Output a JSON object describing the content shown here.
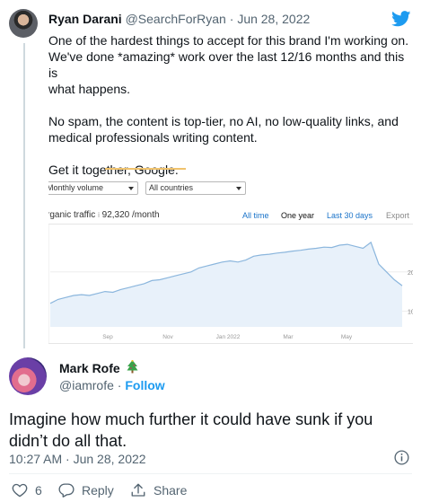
{
  "tweet": {
    "author_name": "Ryan Darani",
    "author_handle": "@SearchForRyan",
    "separator": " · ",
    "date": "Jun 28, 2022",
    "paragraphs": [
      "One of the hardest things to accept for this brand I'm working on.\nWe've done *amazing* work over the last 12/16 months and this is\nwhat happens.",
      "No spam, the content is top-tier, no AI, no low-quality links, and\nmedical professionals writing content.",
      "Get it together, Google."
    ]
  },
  "embedded_screenshot": {
    "volume_select": "Monthly volume",
    "country_select": "All countries",
    "metric_label": "rganic traffic",
    "info_glyph": "i",
    "metric_value": "92,320 /month",
    "ranges": {
      "all_time": "All time",
      "one_year": "One year",
      "last_30": "Last 30 days",
      "export": "Export"
    },
    "selected_range": "One year",
    "accent_color": "#1a73c9",
    "chart_data": {
      "type": "area",
      "title": "",
      "xlabel": "",
      "ylabel": "",
      "x_ticks": [
        "Sep",
        "Nov",
        "Jan 2022",
        "Mar",
        "May"
      ],
      "y_ticks": [
        "20",
        "10"
      ],
      "series": [
        {
          "values": [
            12,
            13,
            13.5,
            14,
            14.2,
            14,
            14.5,
            15,
            14.8,
            15.5,
            16,
            16.5,
            17,
            17.8,
            18,
            18.5,
            19,
            19.5,
            20,
            21,
            21.5,
            22,
            22.5,
            22.8,
            22.5,
            23,
            24,
            24.3,
            24.5,
            24.8,
            25,
            25.3,
            25.5,
            25.8,
            26,
            26.3,
            26.2,
            26.8,
            27,
            26.5,
            26,
            27.5,
            22,
            20,
            18,
            16.5
          ]
        }
      ],
      "ylim": [
        6,
        30
      ],
      "line_color": "#8bb6dd",
      "fill_color": "#e8f1fa"
    }
  },
  "reply": {
    "author_name": "Mark Rofe",
    "author_handle": "@iamrofe",
    "dot": " · ",
    "follow_label": "Follow",
    "text": "Imagine how much further it could have sunk if you didn’t do all that.",
    "timestamp": "10:27 AM · Jun 28, 2022",
    "likes": "6",
    "reply_label": "Reply",
    "share_label": "Share",
    "icons": [
      "heart-icon",
      "reply-icon",
      "share-icon",
      "info-icon",
      "twitter-logo-icon",
      "christmas-tree-icon"
    ],
    "brand_color": "#1d9bf0"
  }
}
